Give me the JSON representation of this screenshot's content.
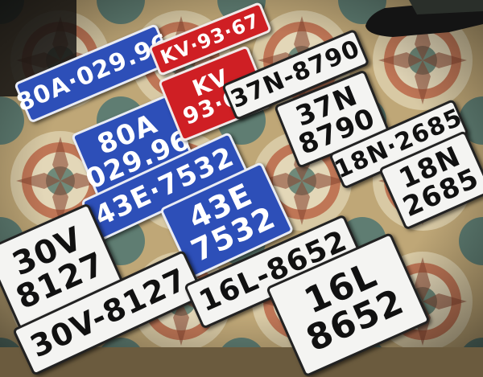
{
  "plates": [
    {
      "id": "80a-1",
      "color": "blue",
      "lines": [
        "80A·029.96"
      ]
    },
    {
      "id": "80a-2",
      "color": "blue",
      "lines": [
        "80A",
        "029.96"
      ]
    },
    {
      "id": "kv-1",
      "color": "red",
      "lines": [
        "KV·93·67"
      ]
    },
    {
      "id": "kv-2",
      "color": "red",
      "lines": [
        "KV",
        "93·67"
      ]
    },
    {
      "id": "37n-1",
      "color": "white",
      "lines": [
        "37N-8790"
      ]
    },
    {
      "id": "37n-2",
      "color": "white",
      "lines": [
        "37N",
        "8790"
      ]
    },
    {
      "id": "43e-1",
      "color": "blue",
      "lines": [
        "43E·7532"
      ]
    },
    {
      "id": "43e-2",
      "color": "blue",
      "lines": [
        "43E",
        "7532"
      ]
    },
    {
      "id": "18n-1",
      "color": "white",
      "lines": [
        "18N·2685"
      ]
    },
    {
      "id": "18n-2",
      "color": "white",
      "lines": [
        "18N",
        "2685"
      ]
    },
    {
      "id": "30v-2",
      "color": "white",
      "lines": [
        "30V",
        "8127"
      ]
    },
    {
      "id": "30v-1",
      "color": "white",
      "lines": [
        "30V-8127"
      ]
    },
    {
      "id": "16l-1",
      "color": "white",
      "lines": [
        "16L-8652"
      ]
    },
    {
      "id": "16l-2",
      "color": "white",
      "lines": [
        "16L",
        "8652"
      ]
    }
  ],
  "colors": {
    "floor": "#6b5b3e",
    "tile": "#c9b48a",
    "blue": "#2d4fb8",
    "red": "#cf1f24",
    "white": "#f4f4f2"
  }
}
